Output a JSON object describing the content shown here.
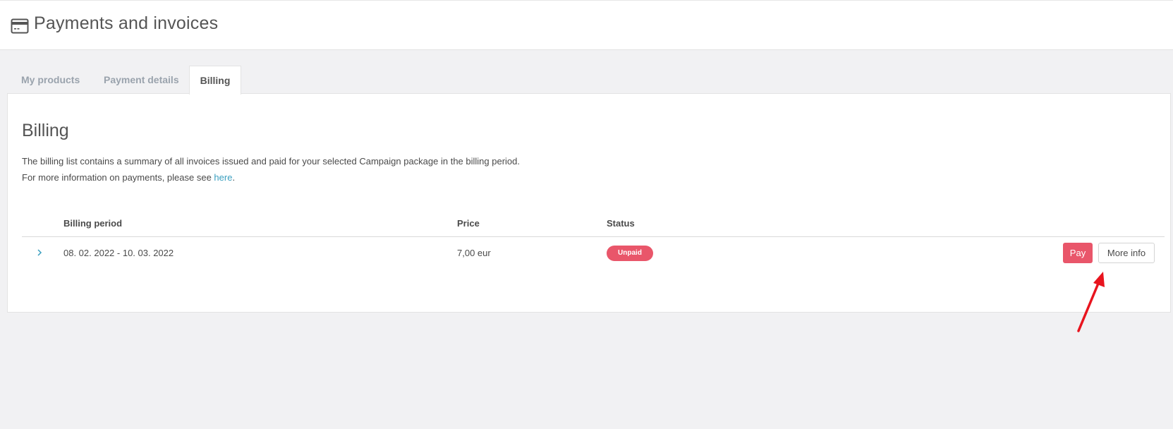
{
  "header": {
    "title": "Payments and invoices",
    "icon": "credit-card-icon"
  },
  "tabs": [
    {
      "label": "My products",
      "active": false
    },
    {
      "label": "Payment details",
      "active": false
    },
    {
      "label": "Billing",
      "active": true
    }
  ],
  "billing": {
    "title": "Billing",
    "description_line1": "The billing list contains a summary of all invoices issued and paid for your selected Campaign package in the billing period.",
    "description_line2_prefix": "For more information on payments, please see ",
    "description_link": "here",
    "description_line2_suffix": "."
  },
  "table": {
    "columns": [
      "Billing period",
      "Price",
      "Status"
    ],
    "rows": [
      {
        "billing_period": "08. 02. 2022 - 10. 03. 2022",
        "price": "7,00 eur",
        "status": "Unpaid",
        "pay_label": "Pay",
        "more_info_label": "More info"
      }
    ]
  },
  "colors": {
    "accent_red": "#e9566a",
    "link": "#3a9fbf",
    "annotation_arrow": "#e8141e"
  }
}
